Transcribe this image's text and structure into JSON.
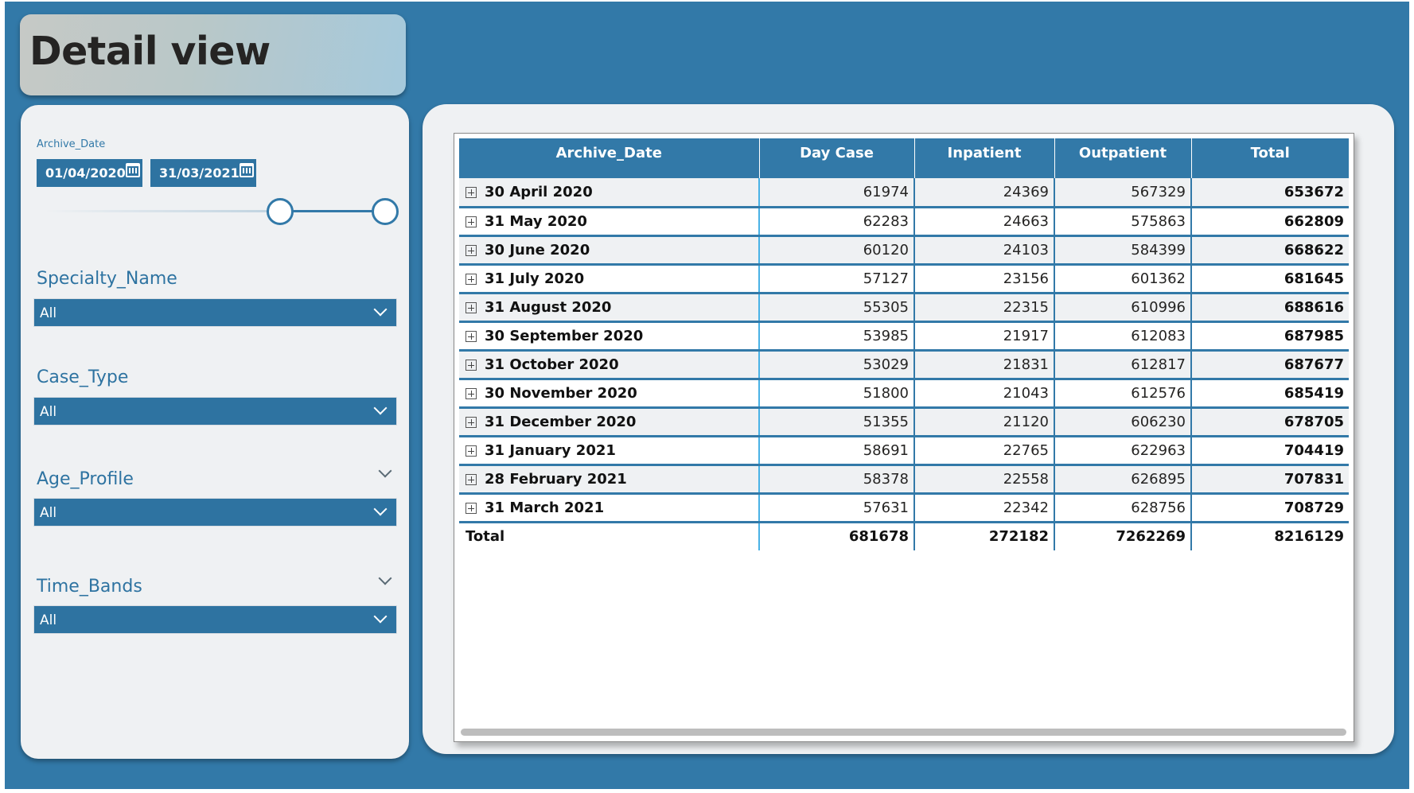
{
  "page_title": "Detail view",
  "filters": {
    "archive_date": {
      "label": "Archive_Date",
      "start": "01/04/2020",
      "end": "31/03/2021"
    },
    "specialty": {
      "label": "Specialty_Name",
      "value": "All"
    },
    "case_type": {
      "label": "Case_Type",
      "value": "All"
    },
    "age_profile": {
      "label": "Age_Profile",
      "value": "All"
    },
    "time_bands": {
      "label": "Time_Bands",
      "value": "All"
    }
  },
  "table": {
    "columns": [
      "Archive_Date",
      "Day Case",
      "Inpatient",
      "Outpatient",
      "Total"
    ],
    "rows": [
      {
        "date": "30 April 2020",
        "day_case": "61974",
        "inpatient": "24369",
        "outpatient": "567329",
        "total": "653672"
      },
      {
        "date": "31 May 2020",
        "day_case": "62283",
        "inpatient": "24663",
        "outpatient": "575863",
        "total": "662809"
      },
      {
        "date": "30 June 2020",
        "day_case": "60120",
        "inpatient": "24103",
        "outpatient": "584399",
        "total": "668622"
      },
      {
        "date": "31 July 2020",
        "day_case": "57127",
        "inpatient": "23156",
        "outpatient": "601362",
        "total": "681645"
      },
      {
        "date": "31 August 2020",
        "day_case": "55305",
        "inpatient": "22315",
        "outpatient": "610996",
        "total": "688616"
      },
      {
        "date": "30 September 2020",
        "day_case": "53985",
        "inpatient": "21917",
        "outpatient": "612083",
        "total": "687985"
      },
      {
        "date": "31 October 2020",
        "day_case": "53029",
        "inpatient": "21831",
        "outpatient": "612817",
        "total": "687677"
      },
      {
        "date": "30 November 2020",
        "day_case": "51800",
        "inpatient": "21043",
        "outpatient": "612576",
        "total": "685419"
      },
      {
        "date": "31 December 2020",
        "day_case": "51355",
        "inpatient": "21120",
        "outpatient": "606230",
        "total": "678705"
      },
      {
        "date": "31 January 2021",
        "day_case": "58691",
        "inpatient": "22765",
        "outpatient": "622963",
        "total": "704419"
      },
      {
        "date": "28 February 2021",
        "day_case": "58378",
        "inpatient": "22558",
        "outpatient": "626895",
        "total": "707831"
      },
      {
        "date": "31 March 2021",
        "day_case": "57631",
        "inpatient": "22342",
        "outpatient": "628756",
        "total": "708729"
      }
    ],
    "totals": {
      "label": "Total",
      "day_case": "681678",
      "inpatient": "272182",
      "outpatient": "7262269",
      "total": "8216129"
    }
  },
  "icons": {
    "calendar": "calendar-icon",
    "chevron": "chevron-down-icon",
    "expand": "expand-plus-icon"
  },
  "colors": {
    "background": "#3279a8",
    "panel": "#eff1f3",
    "header": "#3279a8",
    "accent_divider": "#49b2e6"
  }
}
